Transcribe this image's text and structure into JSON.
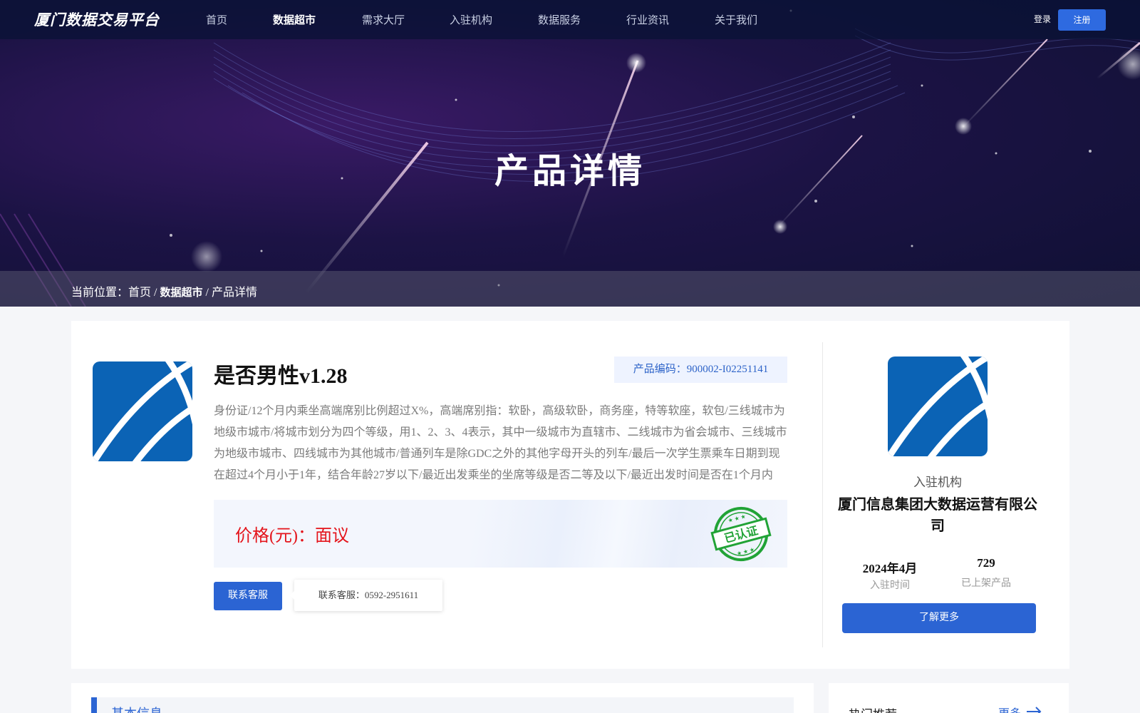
{
  "brand": {
    "logo_text": "厦门数据交易平台"
  },
  "nav": {
    "items": [
      {
        "label": "首页",
        "active": false
      },
      {
        "label": "数据超市",
        "active": true
      },
      {
        "label": "需求大厅",
        "active": false
      },
      {
        "label": "入驻机构",
        "active": false
      },
      {
        "label": "数据服务",
        "active": false
      },
      {
        "label": "行业资讯",
        "active": false
      },
      {
        "label": "关于我们",
        "active": false
      }
    ],
    "login": "登录",
    "register": "注册"
  },
  "hero": {
    "title": "产品详情"
  },
  "breadcrumb": {
    "prefix": "当前位置：",
    "home": "首页",
    "sep1": " /",
    "market": "数据超市",
    "sep2": " /",
    "current": "产品详情"
  },
  "product": {
    "name": "是否男性v1.28",
    "code": "产品编码：900002-I02251141",
    "description": "身份证/12个月内乘坐高端席别比例超过X%，高端席别指：软卧，高级软卧，商务座，特等软座，软包/三线城市为地级市城市/将城市划分为四个等级，用1、2、3、4表示，其中一级城市为直辖市、二线城市为省会城市、三线城市为地级市城市、四线城市为其他城市/普通列车是除GDC之外的其他字母开头的列车/最后一次学生票乘车日期到现在超过4个月小于1年，结合年龄27岁以下/最近出发乘坐的坐席等级是否二等及以下/最近出发时间是否在1个月内",
    "price": "价格(元)：面议",
    "stamp_text": "已认证",
    "contact_button": "联系客服",
    "contact_tooltip": "联系客服：0592-2951611"
  },
  "org": {
    "label": "入驻机构",
    "name": "厦门信息集团大数据运营有限公司",
    "joined_value": "2024年4月",
    "joined_label": "入驻时间",
    "products_value": "729",
    "products_label": "已上架产品",
    "more_button": "了解更多"
  },
  "basic": {
    "title": "基本信息"
  },
  "hot": {
    "title": "热门推荐",
    "more": "更多"
  },
  "colors": {
    "primary": "#2b64d3",
    "price_red": "#e4141b",
    "logo_blue": "#0b63b5",
    "stamp_green": "#21a336"
  }
}
